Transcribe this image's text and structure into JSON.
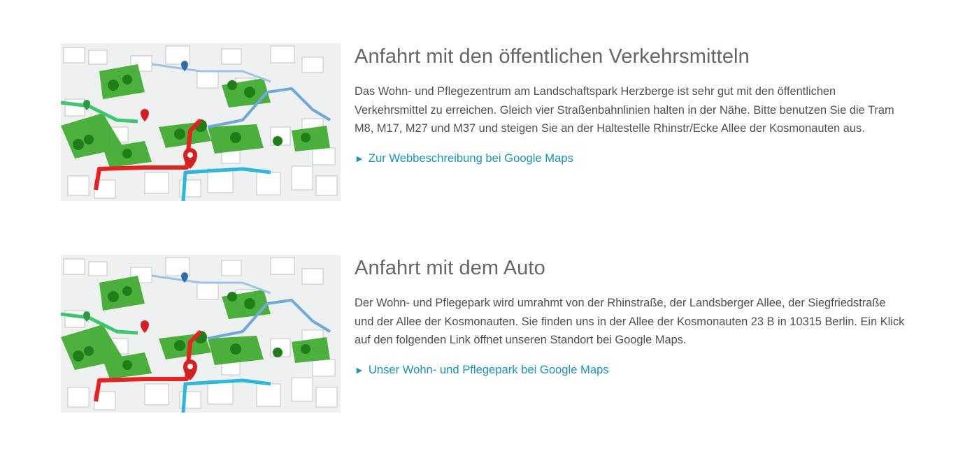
{
  "sections": [
    {
      "title": "Anfahrt mit den öffentlichen Verkehrsmitteln",
      "body": "Das Wohn- und Pflegezentrum am Landschaftspark Herzberge ist sehr gut mit den öffentlichen Verkehrsmittel zu erreichen. Gleich vier Straßenbahnlinien halten in der Nähe. Bitte benutzen Sie die Tram M8, M17, M27 und M37 und steigen Sie an der Haltestelle Rhinstr/Ecke Allee der Kosmonauten aus.",
      "link_arrow": "►",
      "link_label": "Zur Webbeschreibung bei Google Maps"
    },
    {
      "title": "Anfahrt mit dem Auto",
      "body": "Der Wohn- und Pflegepark wird umrahmt von der Rhinstraße, der Landsberger Allee, der Siegfriedstraße und der Allee der Kosmonauten. Sie finden uns in der Allee der Kosmonauten 23 B in 10315 Berlin. Ein Klick auf den folgenden Link öffnet unseren Standort bei Google Maps.",
      "link_arrow": "►",
      "link_label": "Unser Wohn- und Pflegepark bei Google Maps"
    }
  ],
  "colors": {
    "link": "#1595ba",
    "title": "#666666",
    "body": "#4f4f4f",
    "route_red": "#e8201f",
    "route_blue": "#6fa8dc",
    "route_cyan": "#2ab7e0",
    "route_green": "#3cc86a",
    "park_green": "#3aa829"
  }
}
